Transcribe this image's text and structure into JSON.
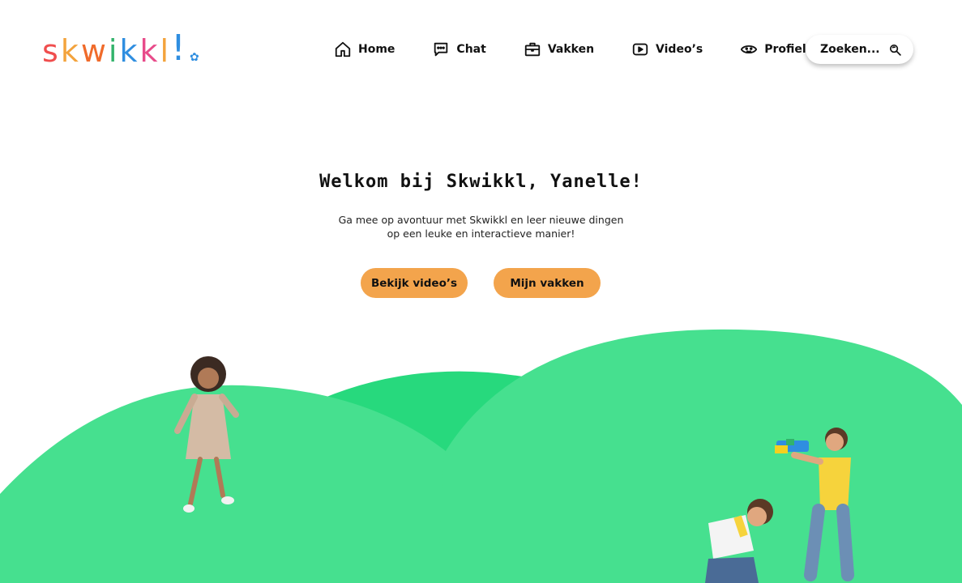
{
  "logo": {
    "letters": [
      "s",
      "k",
      "w",
      "i",
      "k",
      "k",
      "l",
      "!"
    ],
    "colors": [
      "#f04e4e",
      "#f3a33c",
      "#f06b2b",
      "#32b36b",
      "#2f8ee0",
      "#e84b8a",
      "#f3a33c",
      "#2f8ee0"
    ],
    "flower": "✿"
  },
  "nav": {
    "items": [
      {
        "label": "Home",
        "icon": "home-icon"
      },
      {
        "label": "Chat",
        "icon": "chat-icon"
      },
      {
        "label": "Vakken",
        "icon": "briefcase-icon"
      },
      {
        "label": "Video’s",
        "icon": "play-icon"
      },
      {
        "label": "Profiel",
        "icon": "face-icon"
      }
    ]
  },
  "search": {
    "placeholder": "Zoeken...",
    "icon": "search-icon"
  },
  "hero": {
    "title": "Welkom bij Skwikkl, Yanelle!",
    "subtitle": "Ga mee op avontuur met Skwikkl en leer nieuwe dingen op een leuke en interactieve manier!",
    "buttons": {
      "videos": "Bekijk video’s",
      "courses": "Mijn vakken"
    }
  },
  "colors": {
    "accent": "#f3a44c",
    "hill_light": "#46e08f",
    "hill_dark": "#27d97d"
  }
}
